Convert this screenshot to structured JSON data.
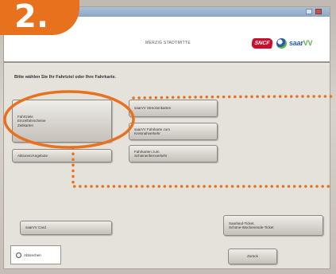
{
  "step_badge": "2.",
  "header": {
    "station": "MERZIG STADTMITTE",
    "logo_sncf": "SNCF",
    "logo_saarvv_prefix": "saar",
    "logo_saarvv_suffix": "VV"
  },
  "instruction": "Bitte wählen Sie Ihr Fahrtziel oder Ihre Fahrkarte.",
  "buttons": {
    "fahrtziel": [
      "Fahrtziele",
      "Einzelfahrscheine",
      "Zeitkarten"
    ],
    "aktionen": "Aktionen/Angebote",
    "streckenkarten": "saarVV Streckenkarten",
    "ticket_mid": [
      "saarVV Fahrkarte zum",
      "Kreisnahverkehr"
    ],
    "ticket_right": [
      "Fahrkarten zum",
      "Schienenfernverkehr"
    ],
    "saarvv_card": "saarVV Card",
    "saarland_ticket": [
      "Saarland-Ticket,",
      "Schöne-Wochenende-Ticket"
    ],
    "zurueck": "Zurück"
  },
  "corner_option": "Abbrechen",
  "colors": {
    "accent_orange": "#e8711e",
    "sncf_red": "#c8102e",
    "saarvv_blue": "#2a5fa6",
    "saarvv_green": "#5eb34a"
  }
}
